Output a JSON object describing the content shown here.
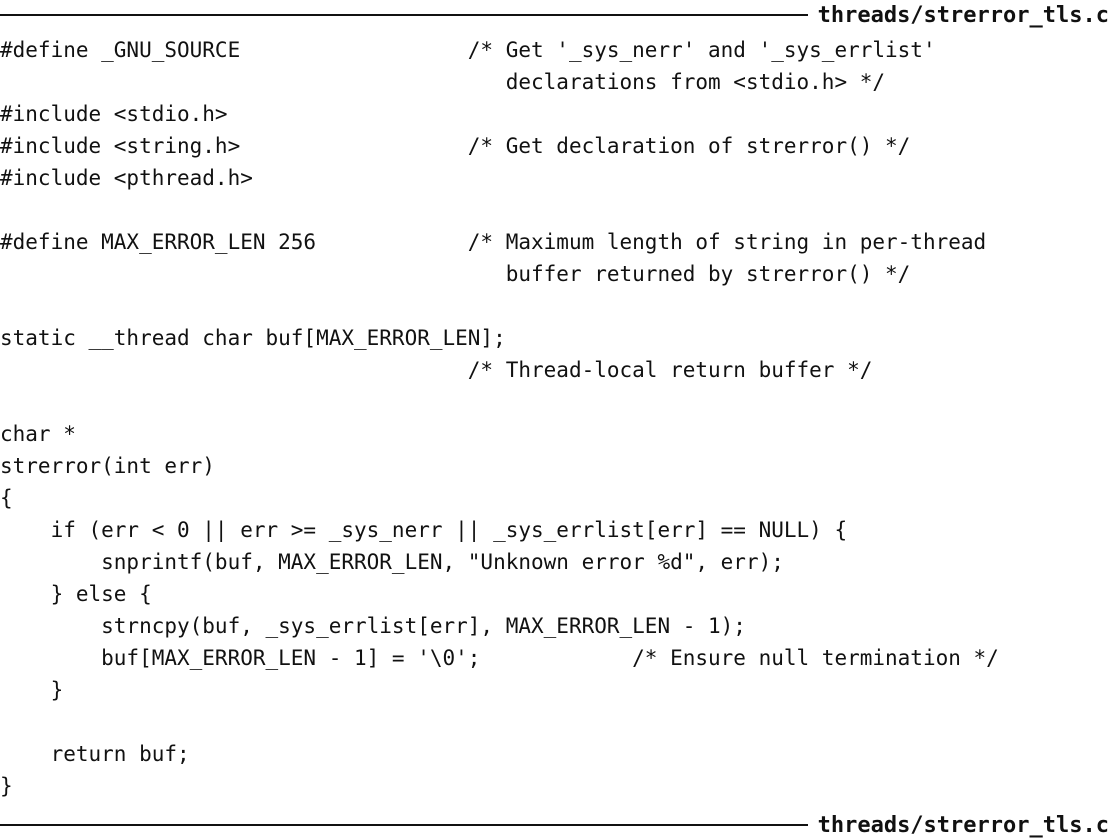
{
  "file_label_top": "threads/strerror_tls.c",
  "file_label_bottom": "threads/strerror_tls.c",
  "code_lines": [
    "#define _GNU_SOURCE                  /* Get '_sys_nerr' and '_sys_errlist'",
    "                                        declarations from <stdio.h> */",
    "#include <stdio.h>",
    "#include <string.h>                  /* Get declaration of strerror() */",
    "#include <pthread.h>",
    "",
    "#define MAX_ERROR_LEN 256            /* Maximum length of string in per-thread",
    "                                        buffer returned by strerror() */",
    "",
    "static __thread char buf[MAX_ERROR_LEN];",
    "                                     /* Thread-local return buffer */",
    "",
    "char *",
    "strerror(int err)",
    "{",
    "    if (err < 0 || err >= _sys_nerr || _sys_errlist[err] == NULL) {",
    "        snprintf(buf, MAX_ERROR_LEN, \"Unknown error %d\", err);",
    "    } else {",
    "        strncpy(buf, _sys_errlist[err], MAX_ERROR_LEN - 1);",
    "        buf[MAX_ERROR_LEN - 1] = '\\0';            /* Ensure null termination */",
    "    }",
    "",
    "    return buf;",
    "}"
  ]
}
